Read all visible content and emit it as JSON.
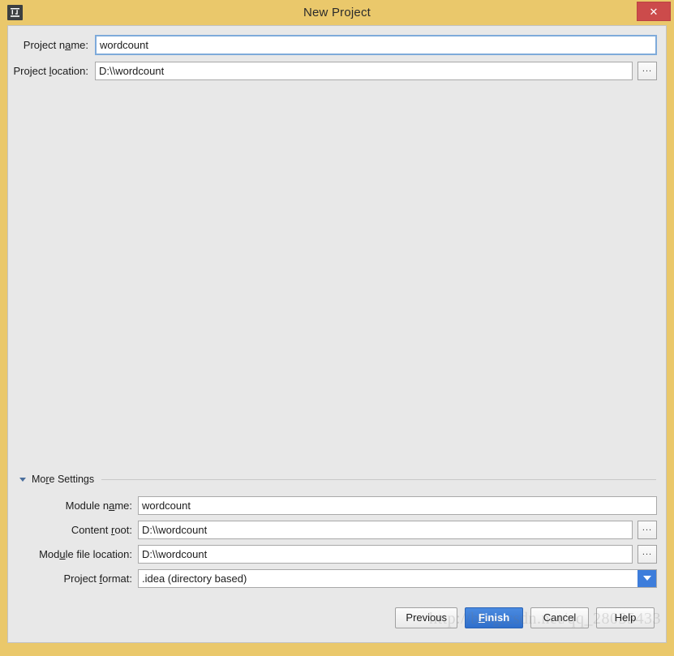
{
  "window": {
    "title": "New Project",
    "app_icon": "intellij-idea-icon",
    "close_label": "✕",
    "frame_color": "#eac86b",
    "body_color": "#e8e8e8"
  },
  "top_form": {
    "rows": [
      {
        "label_before": "Project n",
        "label_mnemonic": "a",
        "label_after": "me:",
        "value": "wordcount",
        "has_browse": false,
        "focused": true
      },
      {
        "label_before": "Project ",
        "label_mnemonic": "l",
        "label_after": "ocation:",
        "value": "D:\\\\wordcount",
        "has_browse": true,
        "focused": false
      }
    ],
    "browse_label": "..."
  },
  "more_settings": {
    "title_before": "Mo",
    "title_mnemonic": "r",
    "title_after": "e Settings",
    "expanded": true,
    "triangle_icon": "triangle-down-icon",
    "rows": [
      {
        "label_before": "Module n",
        "label_mnemonic": "a",
        "label_after": "me:",
        "value": "wordcount",
        "type": "text",
        "has_browse": false
      },
      {
        "label_before": "Content ",
        "label_mnemonic": "r",
        "label_after": "oot:",
        "value": "D:\\\\wordcount",
        "type": "text",
        "has_browse": true
      },
      {
        "label_before": "Mod",
        "label_mnemonic": "u",
        "label_after": "le file location:",
        "value": "D:\\\\wordcount",
        "type": "text",
        "has_browse": true
      },
      {
        "label_before": "Project ",
        "label_mnemonic": "f",
        "label_after": "ormat:",
        "value": ".idea (directory based)",
        "type": "combo",
        "has_browse": false
      }
    ],
    "browse_label": "..."
  },
  "buttons": {
    "previous": "Previous",
    "finish_before": "",
    "finish_mnemonic": "F",
    "finish_after": "inish",
    "cancel": "Cancel",
    "help": "Help"
  },
  "watermark": {
    "text": "http://blog.csdn.net/qq_28035433"
  }
}
